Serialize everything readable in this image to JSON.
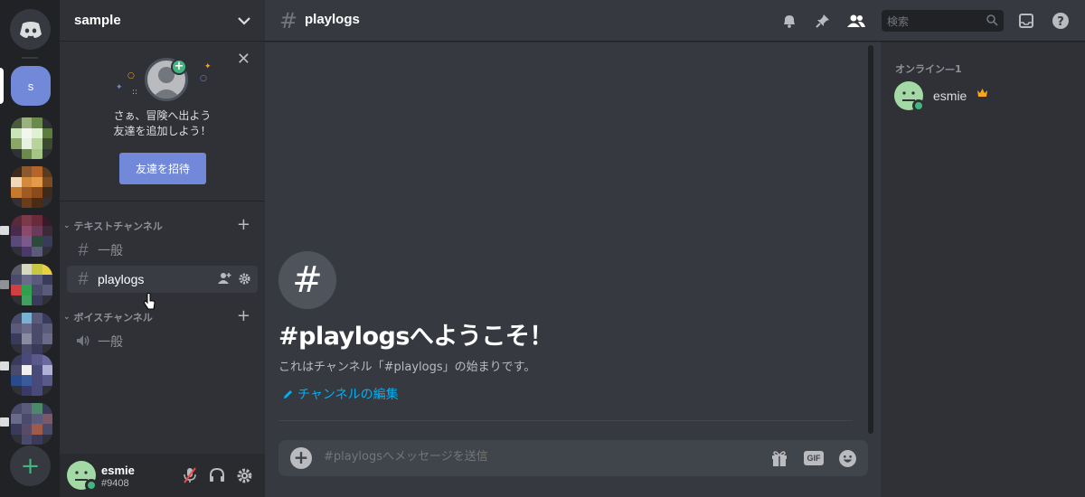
{
  "window": {
    "server_initial": "s"
  },
  "guild": {
    "name": "sample"
  },
  "invite": {
    "line1": "さぁ、冒険へ出よう",
    "line2": "友達を追加しよう！",
    "button": "友達を招待"
  },
  "categories": [
    {
      "label": "テキストチャンネル"
    },
    {
      "label": "ボイスチャンネル"
    }
  ],
  "channels": [
    {
      "label": "一般",
      "type": "text"
    },
    {
      "label": "playlogs",
      "type": "text",
      "active": true
    },
    {
      "label": "一般",
      "type": "voice"
    }
  ],
  "user": {
    "name": "esmie",
    "tag": "#9408"
  },
  "header": {
    "channel": "playlogs",
    "search_placeholder": "検索"
  },
  "welcome": {
    "title": "#playlogsへようこそ！",
    "subtitle": "これはチャンネル「#playlogs」の始まりです。",
    "edit_link": "チャンネルの編集"
  },
  "composer": {
    "placeholder": "#playlogsへメッセージを送信",
    "gif_label": "GIF"
  },
  "members": {
    "heading": "オンライン—1",
    "list": [
      {
        "name": "esmie",
        "owner": true
      }
    ]
  },
  "colors": {
    "accent": "#7289da",
    "online": "#43b581",
    "link": "#00b0f4",
    "crown": "#faa61a"
  },
  "icons": [
    "discord-logo-icon",
    "chevron-down-icon",
    "close-icon",
    "hash-icon",
    "speaker-icon",
    "add-member-icon",
    "gear-icon",
    "mute-mic-icon",
    "headphones-icon",
    "bell-icon",
    "pin-icon",
    "members-icon",
    "search-icon",
    "inbox-icon",
    "help-icon",
    "plus-circle-icon",
    "gift-icon",
    "gif-icon",
    "emoji-icon",
    "crown-icon",
    "pencil-icon"
  ]
}
